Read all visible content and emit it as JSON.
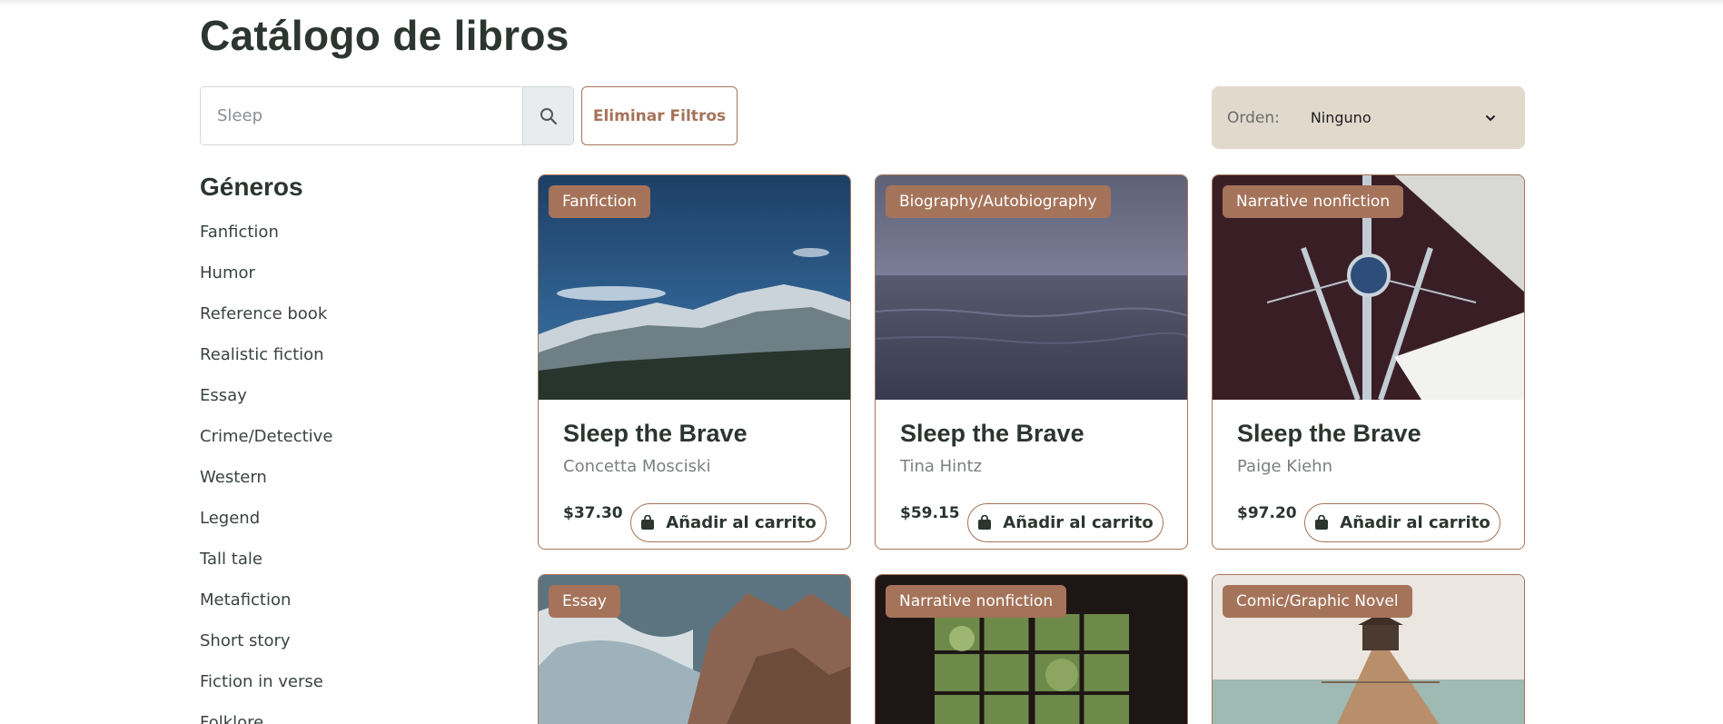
{
  "header": {
    "title": "Catálogo de libros"
  },
  "search": {
    "placeholder": "Sleep",
    "value": "",
    "button_icon": "search-icon"
  },
  "filters": {
    "clear_label": "Eliminar Filtros"
  },
  "sort": {
    "label": "Orden:",
    "selected": "Ninguno",
    "icon": "chevron-down-icon"
  },
  "sidebar": {
    "title": "Géneros",
    "items": [
      "Fanfiction",
      "Humor",
      "Reference book",
      "Realistic fiction",
      "Essay",
      "Crime/Detective",
      "Western",
      "Legend",
      "Tall tale",
      "Metafiction",
      "Short story",
      "Fiction in verse",
      "Folklore"
    ]
  },
  "books": [
    {
      "genre": "Fanfiction",
      "title": "Sleep the Brave",
      "author": "Concetta Mosciski",
      "price": "$37.30",
      "cart_label": "Añadir al carrito",
      "image": "snowy-mountains"
    },
    {
      "genre": "Biography/Autobiography",
      "title": "Sleep the Brave",
      "author": "Tina Hintz",
      "price": "$59.15",
      "cart_label": "Añadir al carrito",
      "image": "misty-sea"
    },
    {
      "genre": "Narrative nonfiction",
      "title": "Sleep the Brave",
      "author": "Paige Kiehn",
      "price": "$97.20",
      "cart_label": "Añadir al carrito",
      "image": "sailboat-bow"
    },
    {
      "genre": "Essay",
      "title": "",
      "author": "",
      "price": "",
      "cart_label": "",
      "image": "waves-rocks"
    },
    {
      "genre": "Narrative nonfiction",
      "title": "",
      "author": "",
      "price": "",
      "cart_label": "",
      "image": "window-trees"
    },
    {
      "genre": "Comic/Graphic Novel",
      "title": "",
      "author": "",
      "price": "",
      "cart_label": "",
      "image": "pier-pavilion"
    }
  ],
  "colors": {
    "accent": "#a5735a",
    "sort_bg": "#e2d9cd",
    "text_dark": "#2c3530"
  }
}
